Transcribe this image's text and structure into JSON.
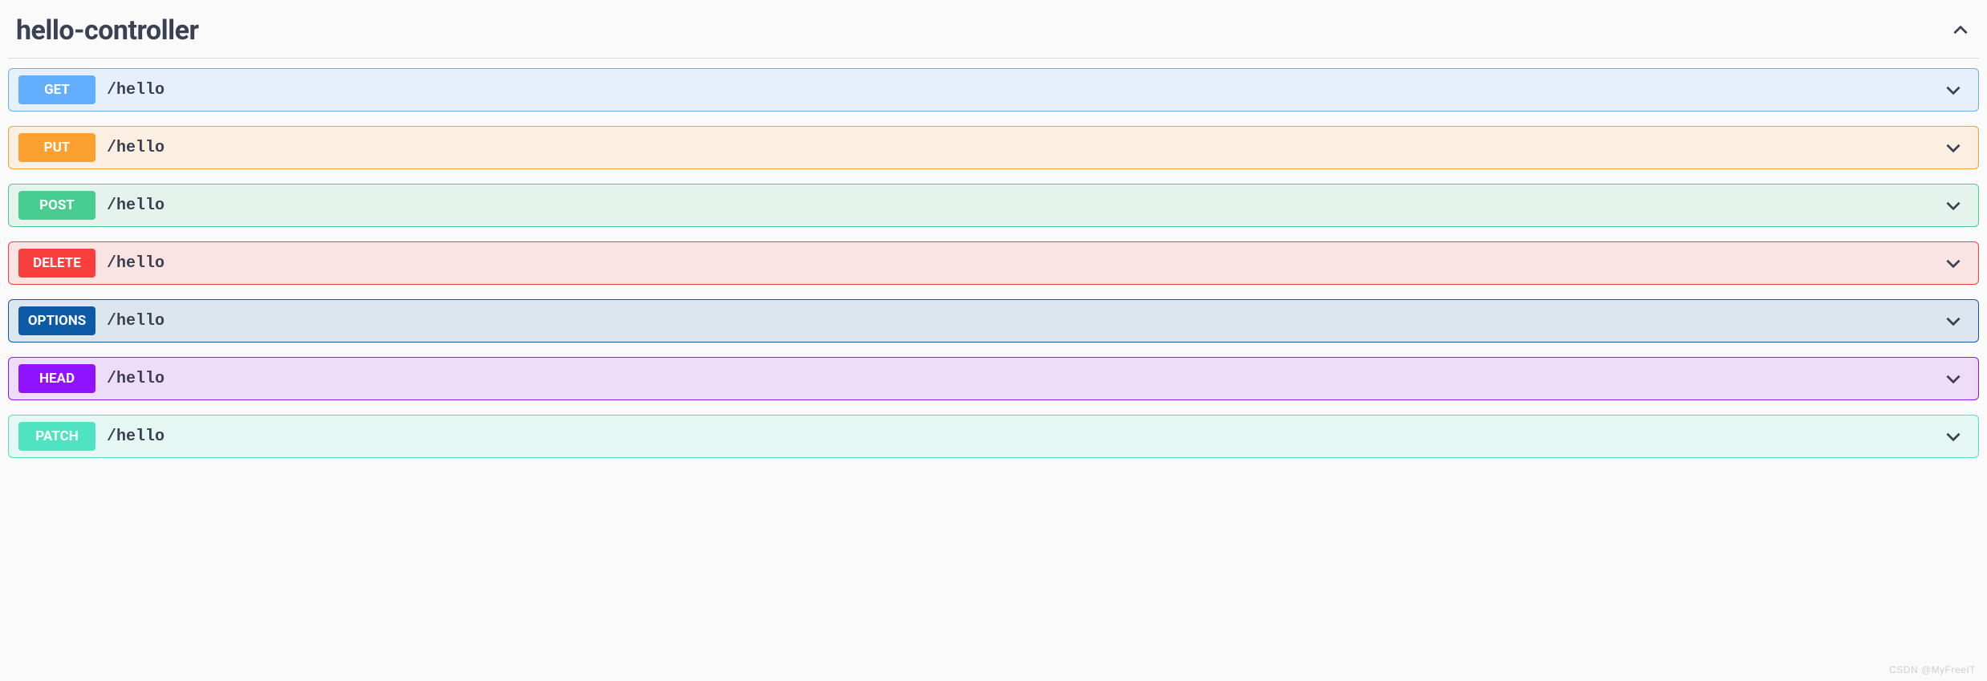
{
  "tag": {
    "name": "hello-controller"
  },
  "operations": [
    {
      "method": "GET",
      "path": "/hello",
      "cls": "op-get"
    },
    {
      "method": "PUT",
      "path": "/hello",
      "cls": "op-put"
    },
    {
      "method": "POST",
      "path": "/hello",
      "cls": "op-post"
    },
    {
      "method": "DELETE",
      "path": "/hello",
      "cls": "op-delete"
    },
    {
      "method": "OPTIONS",
      "path": "/hello",
      "cls": "op-options"
    },
    {
      "method": "HEAD",
      "path": "/hello",
      "cls": "op-head"
    },
    {
      "method": "PATCH",
      "path": "/hello",
      "cls": "op-patch"
    }
  ],
  "watermark": "CSDN @MyFreeIT"
}
